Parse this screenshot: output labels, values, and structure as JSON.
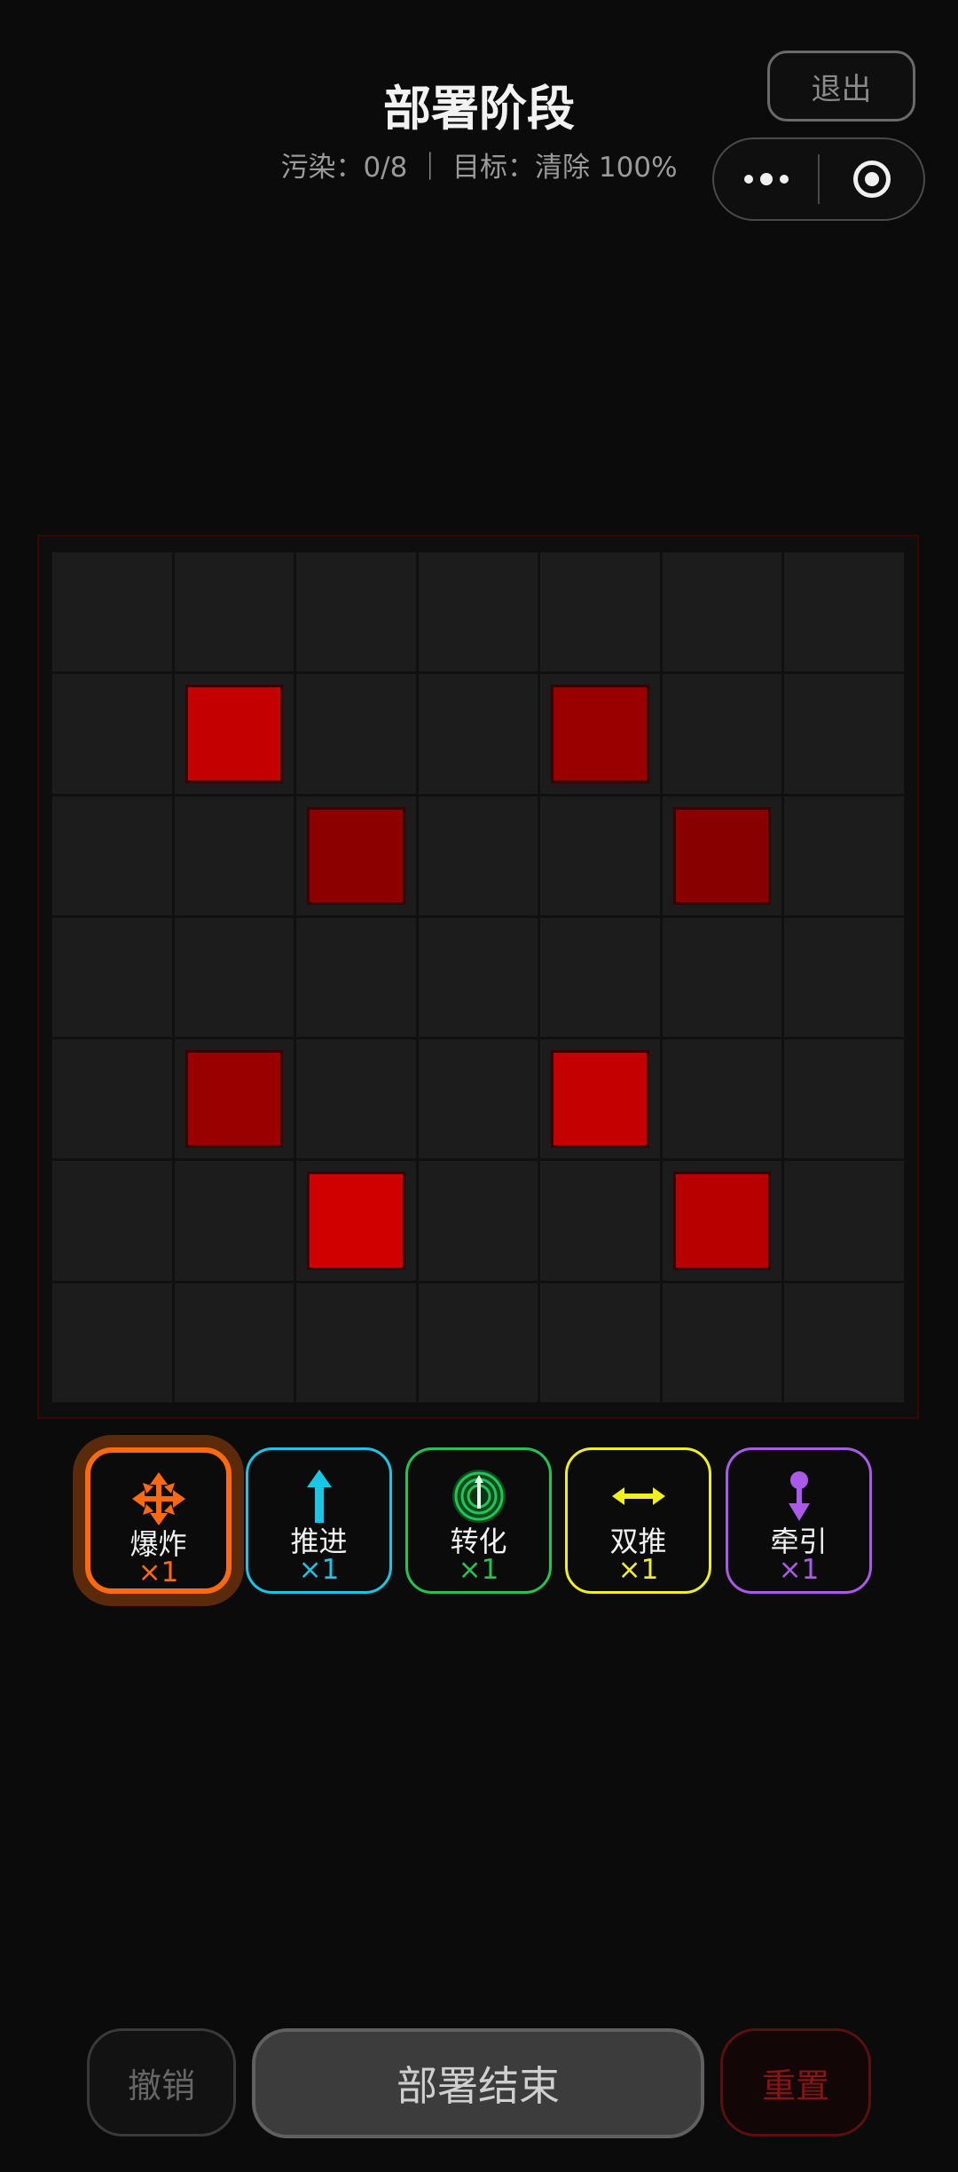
{
  "header": {
    "title": "部署阶段",
    "subtitle": "污染：0/8 ｜ 目标：清除 100%",
    "exit_label": "退出"
  },
  "mini_capsule": {
    "more_icon": "more-dots-icon",
    "close_icon": "target-circle-icon"
  },
  "board": {
    "rows": 7,
    "cols": 7,
    "contaminated": [
      {
        "row": 1,
        "col": 1,
        "color": "#c40000"
      },
      {
        "row": 1,
        "col": 4,
        "color": "#9a0000"
      },
      {
        "row": 2,
        "col": 2,
        "color": "#8c0000"
      },
      {
        "row": 2,
        "col": 5,
        "color": "#880000"
      },
      {
        "row": 4,
        "col": 1,
        "color": "#9a0000"
      },
      {
        "row": 4,
        "col": 4,
        "color": "#c40000"
      },
      {
        "row": 5,
        "col": 2,
        "color": "#d00000"
      },
      {
        "row": 5,
        "col": 5,
        "color": "#b80000"
      }
    ]
  },
  "tools": [
    {
      "id": "explode",
      "label": "爆炸",
      "count": "×1",
      "color": "#ff6a10",
      "icon": "explode-arrows-icon",
      "selected": true
    },
    {
      "id": "push",
      "label": "推进",
      "count": "×1",
      "color": "#19c6e6",
      "icon": "up-arrow-icon",
      "selected": false
    },
    {
      "id": "convert",
      "label": "转化",
      "count": "×1",
      "color": "#22c455",
      "icon": "convert-target-icon",
      "selected": false
    },
    {
      "id": "double_push",
      "label": "双推",
      "count": "×1",
      "color": "#f0f020",
      "icon": "double-arrow-icon",
      "selected": false
    },
    {
      "id": "pull",
      "label": "牵引",
      "count": "×1",
      "color": "#a95be8",
      "icon": "pull-icon",
      "selected": false
    }
  ],
  "bottom": {
    "undo_label": "撤销",
    "end_label": "部署结束",
    "reset_label": "重置"
  }
}
